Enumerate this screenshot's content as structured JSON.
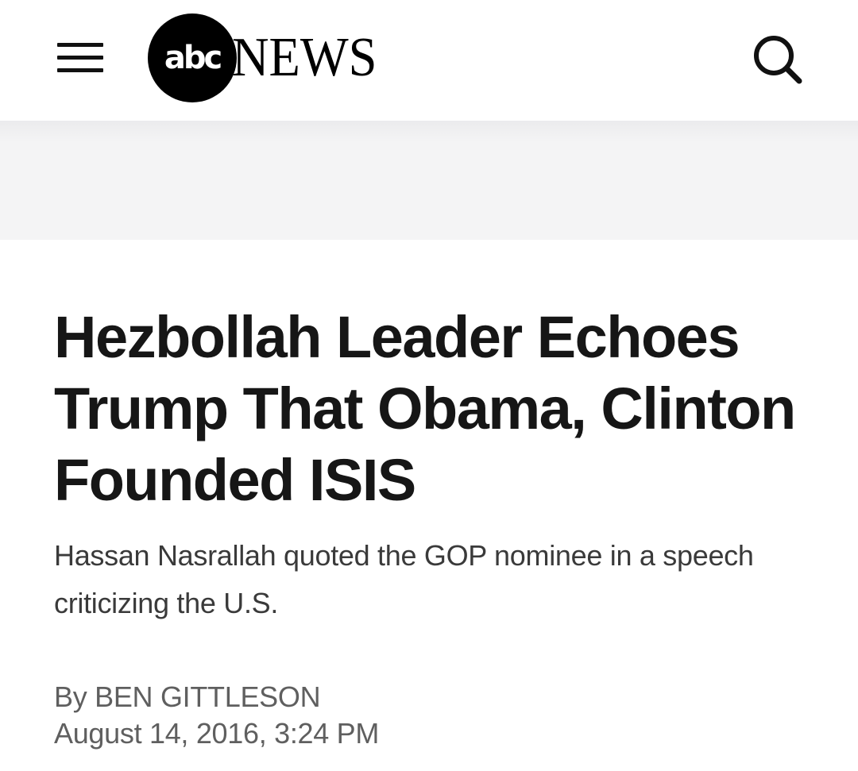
{
  "header": {
    "menu_icon": "hamburger-menu-icon",
    "logo": {
      "mark": "abc",
      "wordmark": "NEWS"
    },
    "search_icon": "search-icon"
  },
  "ad_band": {},
  "article": {
    "headline": "Hezbollah Leader Echoes Trump That Obama, Clinton Founded ISIS",
    "subhead": "Hassan Nasrallah quoted the GOP nominee in a speech criticizing the U.S.",
    "byline_prefix": "By",
    "author": "BEN GITTLESON",
    "date": "August 14, 2016, 3:24 PM"
  },
  "colors": {
    "background": "#ffffff",
    "headline": "#161616",
    "subhead": "#3a3a3a",
    "meta": "#5f5f5f",
    "ad_band": "#f4f4f5"
  }
}
